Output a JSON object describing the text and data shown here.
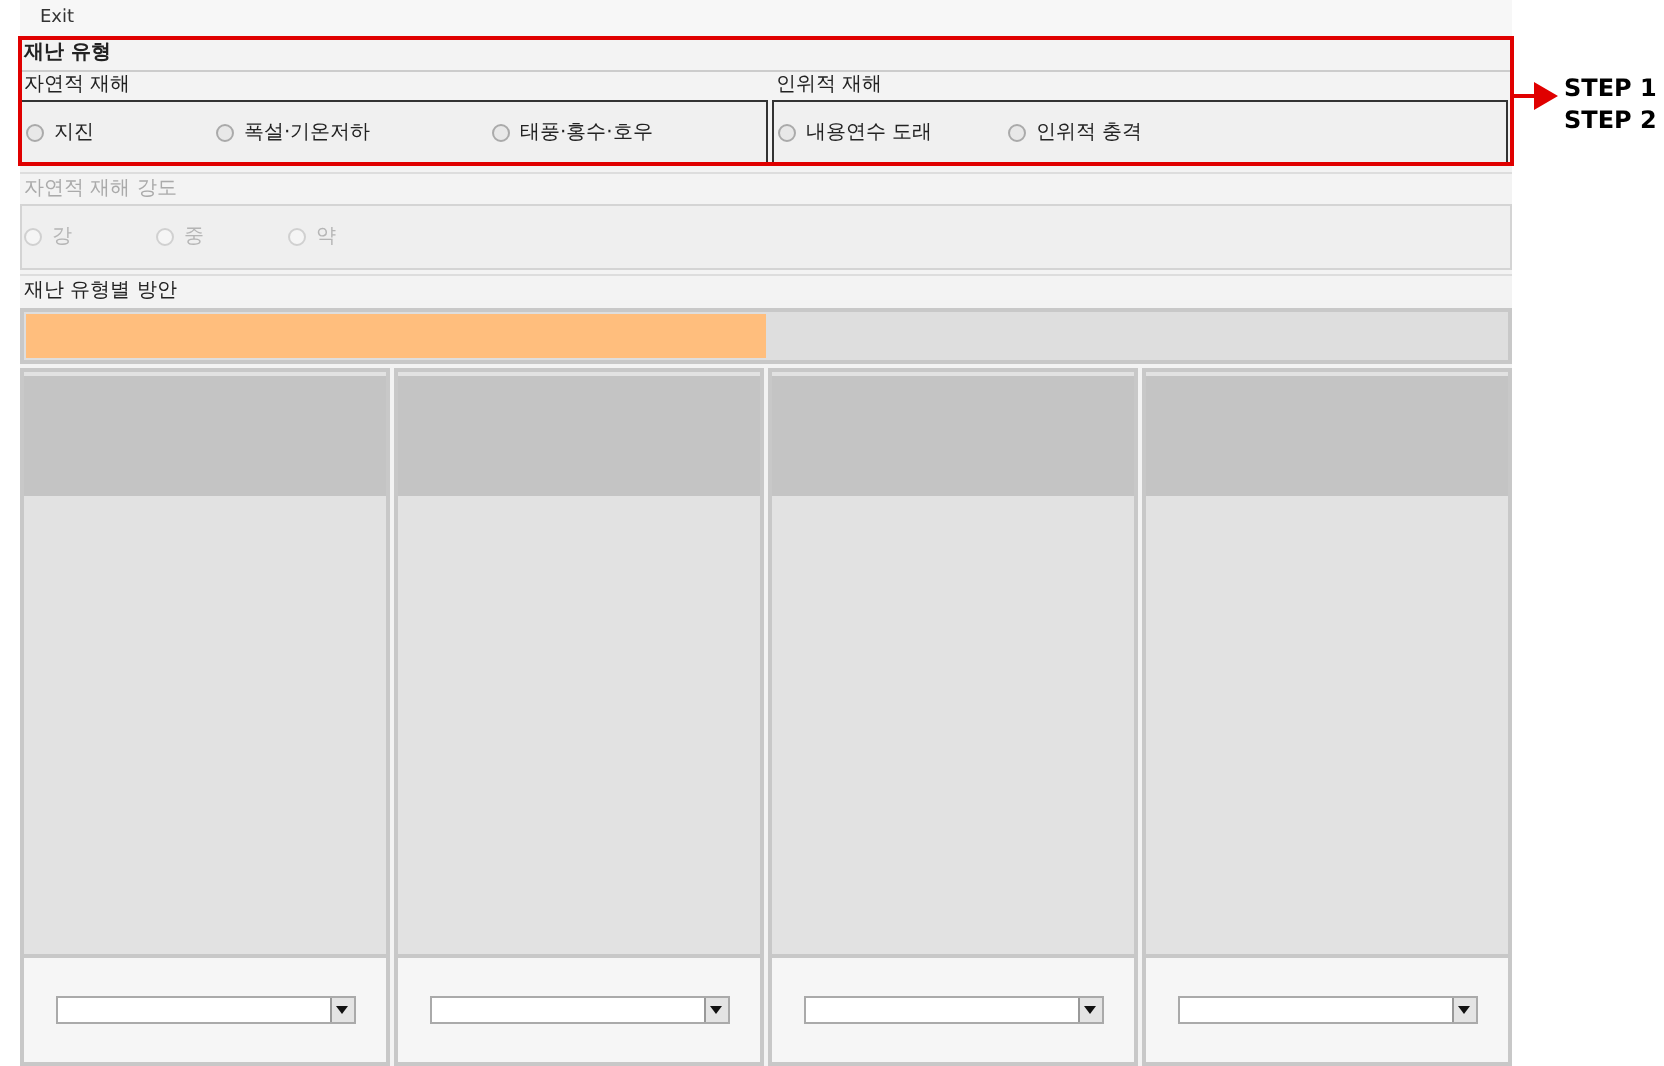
{
  "menu": [
    {
      "label": "Exit"
    }
  ],
  "disaster_type": {
    "title": "재난 유형",
    "groups": [
      {
        "title": "자연적 재해",
        "options": [
          {
            "label": "지진",
            "selected": false
          },
          {
            "label": "폭설·기온저하",
            "selected": false
          },
          {
            "label": "태풍·홍수·호우",
            "selected": false
          }
        ]
      },
      {
        "title": "인위적 재해",
        "options": [
          {
            "label": "내용연수 도래",
            "selected": false
          },
          {
            "label": "인위적 충격",
            "selected": false
          }
        ]
      }
    ]
  },
  "intensity": {
    "title": "자연적 재해 강도",
    "disabled": true,
    "options": [
      {
        "label": "강",
        "selected": false
      },
      {
        "label": "중",
        "selected": false
      },
      {
        "label": "약",
        "selected": false
      }
    ]
  },
  "plans": {
    "title": "재난 유형별 방안",
    "progress": {
      "level": 0.5
    },
    "columns": [
      {
        "kind": "dropdown-panel"
      },
      {
        "kind": "dropdown-panel"
      },
      {
        "kind": "dropdown-panel"
      },
      {
        "kind": "dropdown-panel"
      }
    ]
  },
  "annotation": {
    "steps": [
      "STEP 1",
      "STEP 2"
    ]
  }
}
